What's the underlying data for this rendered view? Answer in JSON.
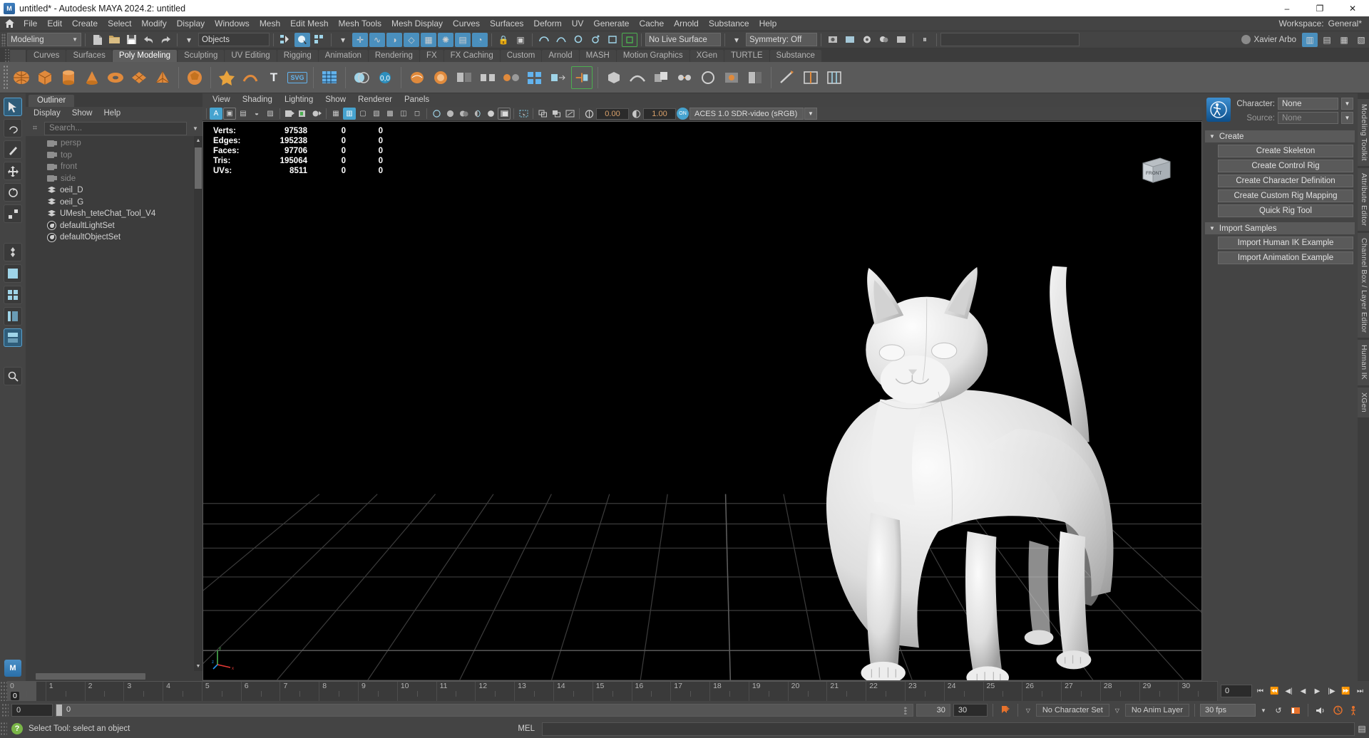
{
  "window": {
    "title": "untitled* - Autodesk MAYA 2024.2: untitled",
    "app_badge": "M",
    "minimize": "–",
    "maximize": "❐",
    "close": "✕"
  },
  "menubar": {
    "home_icon": "home-icon",
    "items": [
      "File",
      "Edit",
      "Create",
      "Select",
      "Modify",
      "Display",
      "Windows",
      "Mesh",
      "Edit Mesh",
      "Mesh Tools",
      "Mesh Display",
      "Curves",
      "Surfaces",
      "Deform",
      "UV",
      "Generate",
      "Cache",
      "Arnold",
      "Substance",
      "Help"
    ],
    "workspace_label": "Workspace:",
    "workspace_value": "General*"
  },
  "statusbar": {
    "mode": "Modeling",
    "selection_mask": "Objects",
    "live_surface": "No Live Surface",
    "symmetry": "Symmetry: Off",
    "user": "Xavier Arbo",
    "search_placeholder": ""
  },
  "shelf": {
    "tabs": [
      "Curves",
      "Surfaces",
      "Poly Modeling",
      "Sculpting",
      "UV Editing",
      "Rigging",
      "Animation",
      "Rendering",
      "FX",
      "FX Caching",
      "Custom",
      "Arnold",
      "MASH",
      "Motion Graphics",
      "XGen",
      "TURTLE",
      "Substance"
    ],
    "active_tab": "Poly Modeling"
  },
  "outliner": {
    "tab_label": "Outliner",
    "menus": [
      "Display",
      "Show",
      "Help"
    ],
    "search_placeholder": "Search...",
    "items": [
      {
        "label": "persp",
        "icon": "camera-icon",
        "dim": true
      },
      {
        "label": "top",
        "icon": "camera-icon",
        "dim": true
      },
      {
        "label": "front",
        "icon": "camera-icon",
        "dim": true
      },
      {
        "label": "side",
        "icon": "camera-icon",
        "dim": true
      },
      {
        "label": "oeil_D",
        "icon": "mesh-icon",
        "dim": false
      },
      {
        "label": "oeil_G",
        "icon": "mesh-icon",
        "dim": false
      },
      {
        "label": "UMesh_teteChat_Tool_V4",
        "icon": "mesh-icon",
        "dim": false
      },
      {
        "label": "defaultLightSet",
        "icon": "set-icon",
        "dim": false
      },
      {
        "label": "defaultObjectSet",
        "icon": "set-icon",
        "dim": false
      }
    ]
  },
  "viewport": {
    "menus": [
      "View",
      "Shading",
      "Lighting",
      "Show",
      "Renderer",
      "Panels"
    ],
    "exposure": "0.00",
    "gamma": "1.00",
    "color_space": "ACES 1.0 SDR-video (sRGB)",
    "viewcube_label": "FRONT",
    "hud": {
      "columns": [
        "name",
        "count",
        "selected",
        "other"
      ],
      "rows": [
        {
          "name": "Verts:",
          "count": "97538",
          "selected": "0",
          "other": "0"
        },
        {
          "name": "Edges:",
          "count": "195238",
          "selected": "0",
          "other": "0"
        },
        {
          "name": "Faces:",
          "count": "97706",
          "selected": "0",
          "other": "0"
        },
        {
          "name": "Tris:",
          "count": "195064",
          "selected": "0",
          "other": "0"
        },
        {
          "name": "UVs:",
          "count": "8511",
          "selected": "0",
          "other": "0"
        }
      ]
    },
    "axis": {
      "x": "x",
      "y": "y",
      "z": "z"
    }
  },
  "humanik": {
    "character_label": "Character:",
    "character_value": "None",
    "source_label": "Source:",
    "source_value": "None",
    "sections": [
      {
        "title": "Create",
        "buttons": [
          "Create Skeleton",
          "Create Control Rig",
          "Create Character Definition",
          "Create Custom Rig Mapping",
          "Quick Rig Tool"
        ]
      },
      {
        "title": "Import Samples",
        "buttons": [
          "Import Human IK Example",
          "Import Animation Example"
        ]
      }
    ]
  },
  "right_tabs": [
    "Modeling Toolkit",
    "Attribute Editor",
    "Channel Box / Layer Editor",
    "Human IK",
    "XGen"
  ],
  "timeline": {
    "frames": [
      "0",
      "1",
      "2",
      "3",
      "4",
      "5",
      "6",
      "7",
      "8",
      "9",
      "10",
      "11",
      "12",
      "13",
      "14",
      "15",
      "16",
      "17",
      "18",
      "19",
      "20",
      "21",
      "22",
      "23",
      "24",
      "25",
      "26",
      "27",
      "28",
      "29",
      "30"
    ],
    "current_frame": "0",
    "current_frame_field": "0"
  },
  "range": {
    "start": "0",
    "slider_value": "0",
    "end_display": "30",
    "end_field": "30",
    "character_set": "No Character Set",
    "anim_layer": "No Anim Layer",
    "fps": "30 fps"
  },
  "status": {
    "help_text": "Select Tool: select an object",
    "mel_label": "MEL",
    "mel_value": ""
  },
  "colors": {
    "accent_blue": "#46a3cf",
    "shelf_orange": "#e08a3c",
    "green": "#7ab648",
    "panel_bg": "#444444",
    "viewport_bg": "#000000"
  }
}
